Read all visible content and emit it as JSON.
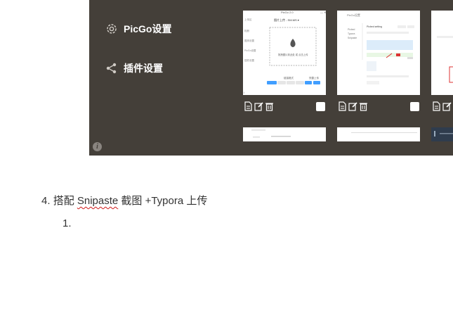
{
  "sidebar": {
    "items": [
      {
        "label": "PicGo设置",
        "icon": "gear-icon"
      },
      {
        "label": "插件设置",
        "icon": "share-icon"
      }
    ]
  },
  "info_icon": "i",
  "thumbnails": {
    "t1": {
      "lines": [
        "PicGo 2.0",
        "图片上传 - SM.MS ▾",
        "拖拽图片到此处 或 点击上传"
      ]
    },
    "t2": {
      "lines": [
        "PicGo设置",
        "Picbed setting",
        "Save"
      ]
    }
  },
  "document": {
    "item4": {
      "number": "4.",
      "before": "搭配 ",
      "link": "Snipaste",
      "after": " 截图 +Typora 上传"
    },
    "subitem": "1."
  },
  "colors": {
    "panel_bg": "#443f39",
    "doc_text": "#333333",
    "accent": "#409eff"
  }
}
